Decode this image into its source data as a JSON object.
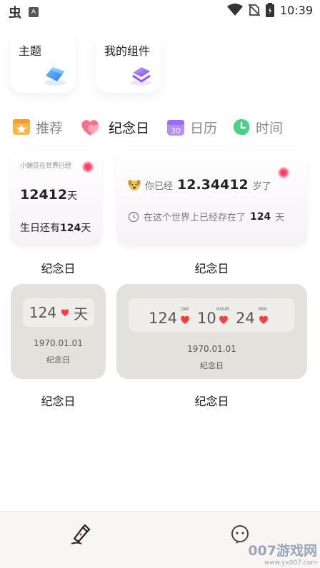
{
  "status_bar": {
    "app_glyph": "虫",
    "a_badge": "A",
    "time": "10:39"
  },
  "top_cards": [
    {
      "title": "主题",
      "icon": "theme-icon"
    },
    {
      "title": "我的组件",
      "icon": "widgets-icon"
    }
  ],
  "tabs": [
    {
      "label": "推荐",
      "icon": "star-badge-icon",
      "active": false
    },
    {
      "label": "纪念日",
      "icon": "heart-icon",
      "active": true
    },
    {
      "label": "日历",
      "icon": "calendar-30-icon",
      "calendar_number": "30",
      "active": false
    },
    {
      "label": "时间",
      "icon": "clock-icon",
      "active": false
    }
  ],
  "widget1": {
    "top_text": "小豌豆在世界已经",
    "days": "12412",
    "days_unit": "天",
    "birthday_prefix": "生日还有",
    "birthday_days": "124",
    "birthday_unit": "天"
  },
  "widget2": {
    "prefix": "你已经",
    "value": "12.34412",
    "suffix": "岁了",
    "line2_prefix": "在这个世界上已经存在了",
    "line2_days": "124",
    "line2_unit": "天"
  },
  "widget3": {
    "count": "124",
    "unit": "天",
    "date": "1970.01.01",
    "caption": "纪念日"
  },
  "widget4": {
    "days": "124",
    "hours": "10",
    "mins": "24",
    "day_label": "DAY",
    "hour_label": "HOUR",
    "min_label": "MIN",
    "date": "1970.01.01",
    "caption": "纪念日"
  },
  "labels": {
    "widget1": "纪念日",
    "widget2": "纪念日",
    "widget3": "纪念日",
    "widget4": "纪念日"
  },
  "bottom_nav": {
    "items": [
      "pen-icon",
      "chat-icon"
    ]
  },
  "watermark": {
    "main": "007游戏网",
    "url": "www.yx007.com"
  },
  "colors": {
    "accent_pink": "#ff3c6a",
    "widget_gray": "#e3e1db"
  }
}
